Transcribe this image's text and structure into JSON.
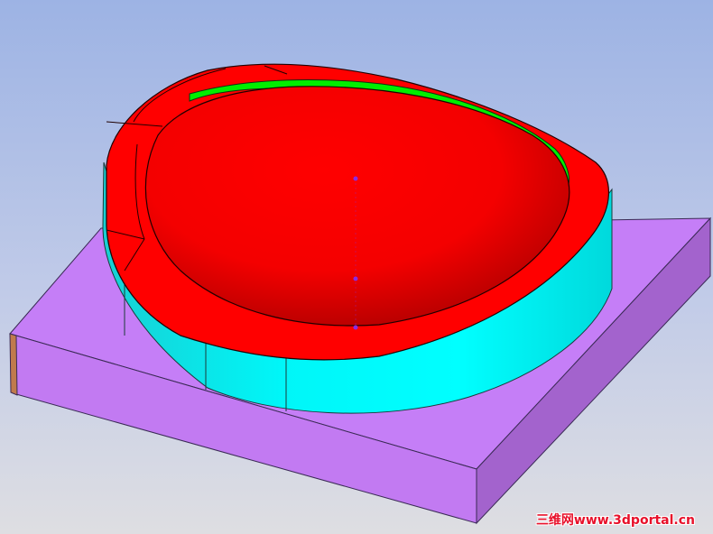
{
  "viewport": {
    "background_top": "#9db3e4",
    "background_bottom": "#dedee2"
  },
  "model": {
    "base_plate": {
      "top_color": "#c57ef7",
      "front_color": "#c27af2",
      "right_color": "#a363cd",
      "edge_color": "#c07a4d"
    },
    "cup_wall": {
      "color": "#00ffff"
    },
    "cup_rim": {
      "color": "#ff0000"
    },
    "inner_strip": {
      "color": "#00ee00"
    },
    "markers": {
      "color": "#8a2be2"
    }
  },
  "watermark": {
    "text": "三维网www.3dportal.cn",
    "color": "#e8102a"
  }
}
